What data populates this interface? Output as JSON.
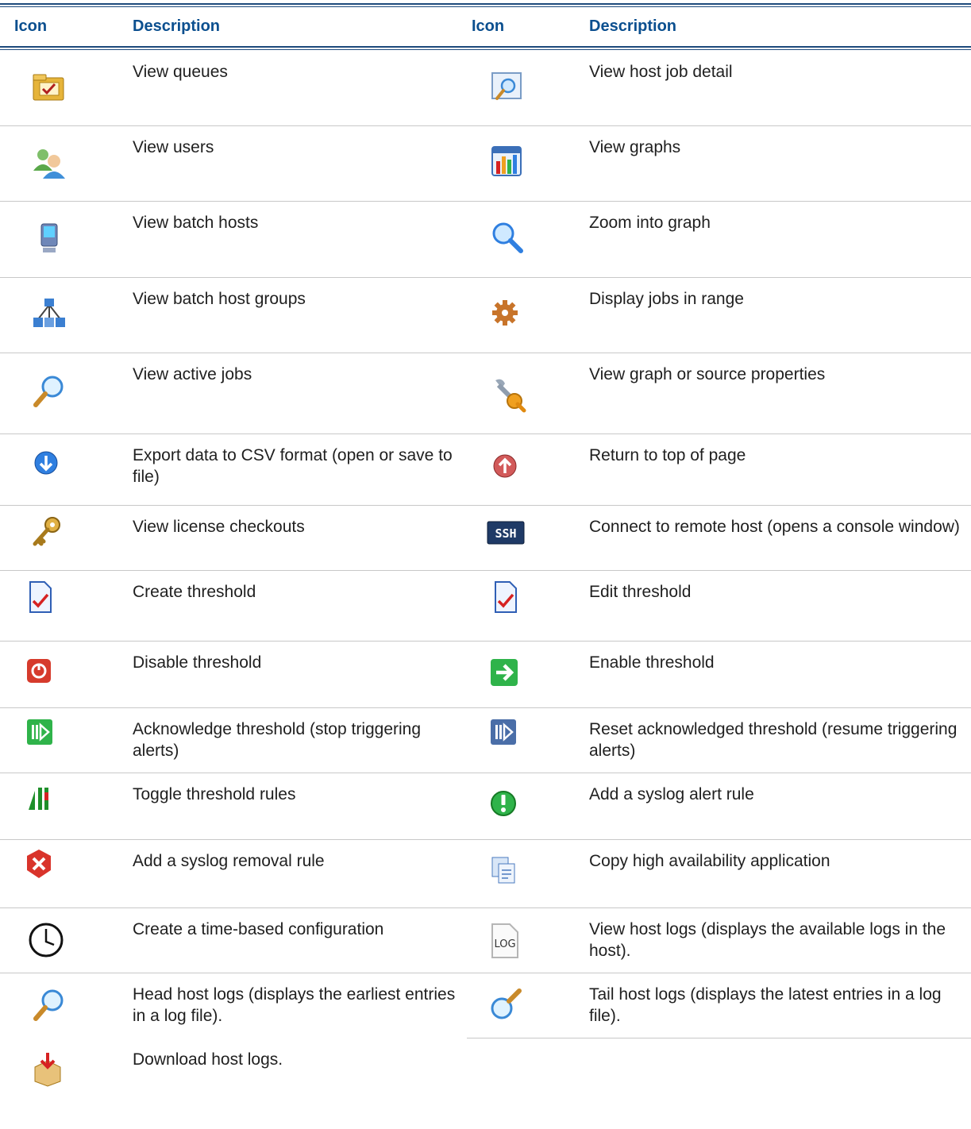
{
  "header": {
    "icon_label_left": "Icon",
    "description_label_left": "Description",
    "icon_label_right": "Icon",
    "description_label_right": "Description"
  },
  "left_rows": [
    {
      "icon": "queue-folder-icon",
      "description": "View queues"
    },
    {
      "icon": "users-icon",
      "description": "View users"
    },
    {
      "icon": "batch-host-icon",
      "description": "View batch hosts"
    },
    {
      "icon": "host-group-icon",
      "description": "View batch host groups"
    },
    {
      "icon": "magnifier-icon",
      "description": "View active jobs"
    },
    {
      "icon": "export-down-arrow-icon",
      "description": "Export data to CSV format (open or save to file)"
    },
    {
      "icon": "key-icon",
      "description": "View license checkouts"
    },
    {
      "icon": "threshold-document-icon",
      "description": "Create threshold"
    },
    {
      "icon": "disable-power-icon",
      "description": "Disable threshold"
    },
    {
      "icon": "acknowledge-green-icon",
      "description": "Acknowledge threshold (stop triggering alerts)"
    },
    {
      "icon": "toggle-bars-icon",
      "description": "Toggle threshold rules"
    },
    {
      "icon": "remove-red-x-icon",
      "description": "Add a syslog removal rule"
    },
    {
      "icon": "clock-icon",
      "description": "Create a time-based configuration"
    },
    {
      "icon": "magnifier-icon",
      "description": "Head host logs (displays the earliest entries in a log file)."
    },
    {
      "icon": "download-box-icon",
      "description": "Download host logs."
    }
  ],
  "right_rows": [
    {
      "icon": "host-job-detail-icon",
      "description": "View host job detail"
    },
    {
      "icon": "graph-icon",
      "description": "View graphs"
    },
    {
      "icon": "zoom-icon",
      "description": "Zoom into graph"
    },
    {
      "icon": "gear-icon",
      "description": "Display jobs in range"
    },
    {
      "icon": "wrench-magnifier-icon",
      "description": "View graph or source properties"
    },
    {
      "icon": "return-up-arrow-icon",
      "description": "Return to top of page"
    },
    {
      "icon": "ssh-console-icon",
      "description": "Connect to remote host (opens a console window)"
    },
    {
      "icon": "threshold-document-icon",
      "description": "Edit threshold"
    },
    {
      "icon": "enable-arrow-icon",
      "description": "Enable threshold"
    },
    {
      "icon": "reset-acknowledge-icon",
      "description": "Reset acknowledged threshold (resume triggering alerts)"
    },
    {
      "icon": "syslog-alert-icon",
      "description": "Add a syslog alert rule"
    },
    {
      "icon": "copy-pages-icon",
      "description": "Copy high availability application"
    },
    {
      "icon": "log-file-icon",
      "description": "View host logs (displays the available logs in the host)."
    },
    {
      "icon": "tail-magnifier-icon",
      "description": "Tail host logs (displays the latest entries in a log file)."
    }
  ],
  "icon_texts": {
    "ssh": "SSH",
    "log": "LOG"
  },
  "colors": {
    "header_text": "#0b4f8f",
    "header_rule": "#1e4a7c",
    "row_divider": "#c8c8c8"
  }
}
